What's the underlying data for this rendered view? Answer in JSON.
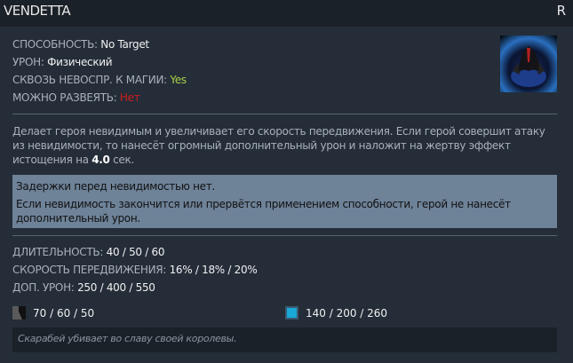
{
  "header": {
    "title": "VENDETTA",
    "hotkey": "R"
  },
  "stats": [
    {
      "label": "СПОСОБНОСТЬ: ",
      "value": "No Target"
    },
    {
      "label": "УРОН: ",
      "value": "Физический"
    },
    {
      "label": "СКВОЗЬ НЕВОСПР. К МАГИИ: ",
      "value": "Yes"
    },
    {
      "label": "МОЖНО РАЗВЕЯТЬ: ",
      "value": "Нет"
    }
  ],
  "description": {
    "text": "Делает героя невидимым и увеличивает его скорость передвижения. Если герой совершит атаку из невидимости, то нанесёт огромный дополнительный урон и наложит на жертву эффект истощения на ",
    "duration": "4.0",
    "unit": " сек."
  },
  "notes": [
    "Задержки перед невидимостью нет.",
    "Если невидимость закончится или прервётся применением способности, герой не нанесёт дополнительный урон."
  ],
  "values": [
    {
      "label": "ДЛИТЕЛЬНОСТЬ: ",
      "value": "40 / 50 / 60"
    },
    {
      "label": "СКОРОСТЬ ПЕРЕДВИЖЕНИЯ: ",
      "value": "16% / 18% / 20%"
    },
    {
      "label": "ДОП. УРОН: ",
      "value": "250 / 400 / 550"
    }
  ],
  "cooldown": "70 / 60 / 50",
  "mana": "140 / 200 / 260",
  "lore": "Скарабей убивает во славу своей королевы.",
  "colors": {
    "mana": "#1aa8d8",
    "yes": "#a8d048",
    "no": "#d01c1c"
  }
}
